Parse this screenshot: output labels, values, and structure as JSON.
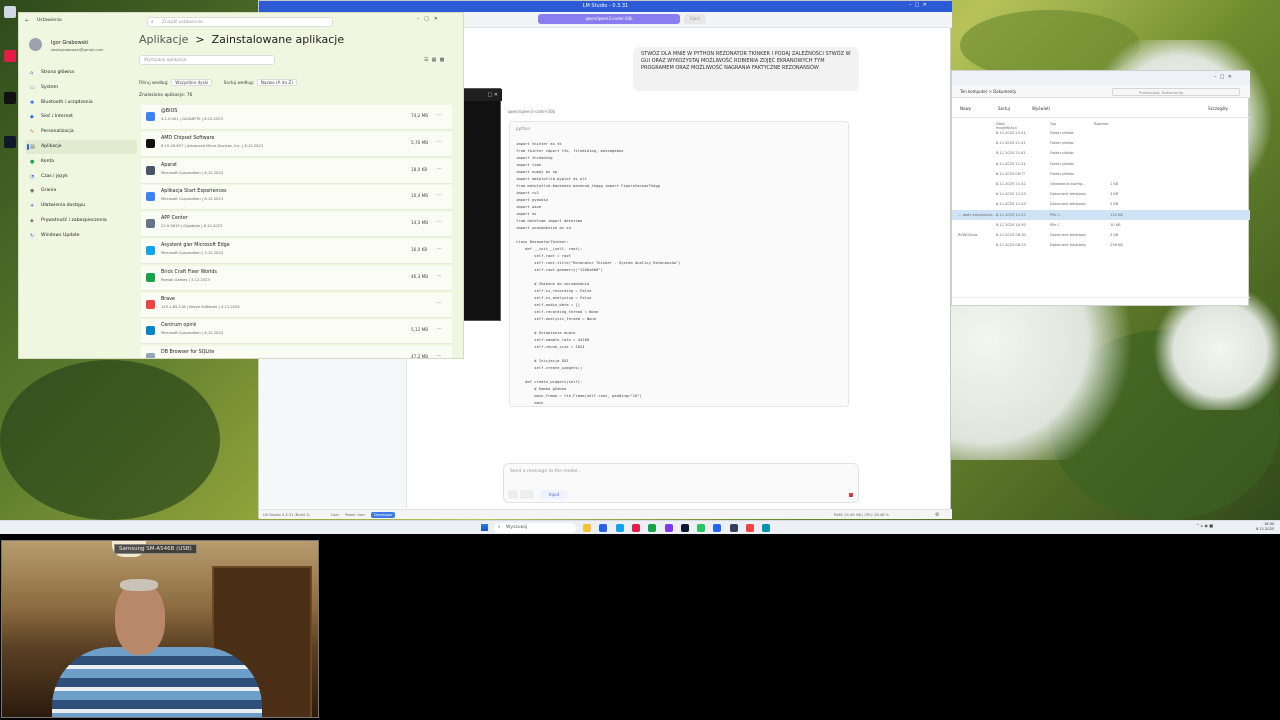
{
  "desktop": {
    "icons": [
      "",
      "",
      "",
      ""
    ],
    "colors": {
      "wallpaper_dark": "#2f4a1c",
      "wallpaper_light": "#b7c35a"
    }
  },
  "lmstudio": {
    "title": "LM Studio - 0.3.31",
    "model": "qwen/qwen3-coder-30b",
    "eject": "Eject",
    "user_message": "STWÓZ DLA MNIE W PYTHON REZONATOR TKINKER I PODAJ ZALEŻNOŚCI STWÓZ W GUI ORAZ WYKOZYSTAJ MOŻLIWOŚĆ ROBIENIA ZDJĘĆ EKRANOWYCH TYM PROGRAMEM ORAZ MOŻLIWOŚĆ NAGRANIA FAKTYCZNE REZONANSÓW",
    "assistant_path": "qwen/qwen3-coder-30b",
    "code_lang": "python",
    "code": "import tkinter as tk\nfrom tkinter import ttk, filedialog, messagebox\nimport threading\nimport time\nimport numpy as np\nimport matplotlib.pyplot as plt\nfrom matplotlib.backends.backend_tkagg import FigureCanvasTkAgg\nimport cv2\nimport pyaudio\nimport wave\nimport os\nfrom datetime import datetime\nimport sounddevice as sd\n\nclass ResonatorTkinker:\n    def __init__(self, root):\n        self.root = root\n        self.root.title(\"Rezonator Tkinker - System Analizy Rezonansów\")\n        self.root.geometry(\"1200x800\")\n\n        # Zmienne do zarządzania\n        self.is_recording = False\n        self.is_analyzing = False\n        self.audio_data = []\n        self.recording_thread = None\n        self.analysis_thread = None\n\n        # Ustawienia audio\n        self.sample_rate = 44100\n        self.chunk_size = 1024\n\n        # Inicjacja GUI\n        self.create_widgets()\n\n    def create_widgets(self):\n        # Ramka główna\n        main_frame = ttk.Frame(self.root, padding=\"10\")\n        main",
    "input_placeholder": "Send a message to the model...",
    "chip": "Input",
    "status_brand": "LM Studio 0.3.31 (Build 1)",
    "status_user": "User",
    "status_power": "Power User",
    "status_dev": "Developer",
    "status_info": "RAM: 15.49 GB | CPU: 26.48 %"
  },
  "explorer": {
    "path": "Ten komputer > Dokumenty",
    "search": "Przeszukaj: Dokumenty",
    "cmd_new": "Nowy",
    "cmd_sort": "Sortuj",
    "cmd_view": "Wyświetl",
    "cmd_details": "Szczegóły",
    "headers": [
      "Data modyfikacji",
      "Typ",
      "Rozmiar"
    ],
    "rows": [
      {
        "name": "",
        "date": "8.11.2025 21:41",
        "type": "Folder plików",
        "size": ""
      },
      {
        "name": "",
        "date": "8.11.2025 21:41",
        "type": "Folder plików",
        "size": ""
      },
      {
        "name": "",
        "date": "8.11.2025 21:41",
        "type": "Folder plików",
        "size": ""
      },
      {
        "name": "",
        "date": "8.11.2025 21:41",
        "type": "Folder plików",
        "size": ""
      },
      {
        "name": "",
        "date": "8.11.2025 06:??",
        "type": "Folder plików",
        "size": ""
      },
      {
        "name": "",
        "date": "8.11.2025 21:42",
        "type": "Ustawienia konfig...",
        "size": "1 KB"
      },
      {
        "name": "",
        "date": "8.11.2025 11:03",
        "type": "Dokument tekstowy",
        "size": "3 KB"
      },
      {
        "name": "",
        "date": "8.11.2025 11:03",
        "type": "Dokument tekstowy",
        "size": "5 KB"
      },
      {
        "name": "... dady empamida...",
        "date": "8.11.2025 11:22",
        "type": "Plik C",
        "size": "110 KB",
        "selected": true
      },
      {
        "name": "",
        "date": "8.11.2025 10:50",
        "type": "Plik C",
        "size": "10 KB"
      },
      {
        "name": "REWOSzaz",
        "date": "8.11.2025 08:30",
        "type": "Dokument tekstowy",
        "size": "3 KB"
      },
      {
        "name": "",
        "date": "8.11.2025 08:15",
        "type": "Dokument tekstowy",
        "size": "236 KB"
      }
    ]
  },
  "settings": {
    "app_title": "Ustawienia",
    "search_placeholder": "Znajdź ustawienie",
    "user_name": "Igor Grabowski",
    "user_email": "iwskigrabowski@gmail.com",
    "nav": [
      {
        "label": "Strona główna",
        "icon": "⌂",
        "color": "#2563eb"
      },
      {
        "label": "System",
        "icon": "▭",
        "color": "#2563eb"
      },
      {
        "label": "Bluetooth i urządzenia",
        "icon": "✱",
        "color": "#2563eb"
      },
      {
        "label": "Sieć i Internet",
        "icon": "◆",
        "color": "#2563eb"
      },
      {
        "label": "Personalizacja",
        "icon": "✎",
        "color": "#d97706"
      },
      {
        "label": "Aplikacje",
        "icon": "▤",
        "color": "#555"
      },
      {
        "label": "Konta",
        "icon": "●",
        "color": "#16a34a"
      },
      {
        "label": "Czas i język",
        "icon": "◔",
        "color": "#2563eb"
      },
      {
        "label": "Granie",
        "icon": "◉",
        "color": "#555"
      },
      {
        "label": "Ułatwienia dostępu",
        "icon": "✦",
        "color": "#2563eb"
      },
      {
        "label": "Prywatność i zabezpieczenia",
        "icon": "◈",
        "color": "#555"
      },
      {
        "label": "Windows Update",
        "icon": "↻",
        "color": "#2563eb"
      }
    ],
    "crumb_parent": "Aplikacje",
    "crumb_sep": ">",
    "crumb_current": "Zainstalowane aplikacje",
    "app_search_placeholder": "Wyszukaj aplikacje",
    "filter_label": "Filtruj według:",
    "filter_value": "Wszystkie dyski",
    "sort_label": "Sortuj według:",
    "sort_value": "Nazwa (A do Z)",
    "count": "Znaleziono aplikacje: 76",
    "apps": [
      {
        "name": "@BIOS",
        "meta": "4.1.0.001  |  GIGABYTE  |  8.12.2023",
        "size": "74,2 MB",
        "color": "#3b82f6"
      },
      {
        "name": "AMD Chipset Software",
        "meta": "6.10.26.657  |  Advanced Micro Devices, Inc.  |  8.12.2023",
        "size": "5,70 MB",
        "color": "#111"
      },
      {
        "name": "Aparat",
        "meta": "Microsoft Corporation  |  8.12.2023",
        "size": "18,0 KB",
        "color": "#475569"
      },
      {
        "name": "Aplikacja Start Experiences",
        "meta": "Microsoft Corporation  |  8.12.2023",
        "size": "10,4 MB",
        "color": "#3b82f6"
      },
      {
        "name": "APP Center",
        "meta": "22.0.0615  |  Gigabyte  |  8.12.2023",
        "size": "14,3 MB",
        "color": "#64748b"
      },
      {
        "name": "Asystent gier Microsoft Edge",
        "meta": "Microsoft Corporation  |  3.12.2023",
        "size": "16,0 KB",
        "color": "#0ea5e9"
      },
      {
        "name": "Brick Craft Fixer Worlds",
        "meta": "Pomak Games  |  3.12.2023",
        "size": "46,3 MB",
        "color": "#16a34a"
      },
      {
        "name": "Brave",
        "meta": "143.1.85.118  |  Brave Software  |  4.11.2024",
        "size": "",
        "color": "#ef4444"
      },
      {
        "name": "Centrum opinii",
        "meta": "Microsoft Corporation  |  8.12.2023",
        "size": "5,12 MB",
        "color": "#0284c7"
      },
      {
        "name": "DB Browser for SQLite",
        "meta": "",
        "size": "47,2 MB",
        "color": "#94a3b8"
      }
    ]
  },
  "taskbar": {
    "search": "Wyszukaj",
    "tray": "^  ⌂  ◉  ■",
    "time": "16:30",
    "date": "8.11.2025",
    "icons": [
      "#f4c430",
      "#2563eb",
      "#0ea5e9",
      "#e11d48",
      "#16a34a",
      "#7c3aed",
      "#0f172a",
      "#22c55e",
      "#2563eb",
      "#334155",
      "#ef4444",
      "#0891b2"
    ]
  },
  "webcam": {
    "device_label": "Samsung SM-A546B (USB)"
  }
}
